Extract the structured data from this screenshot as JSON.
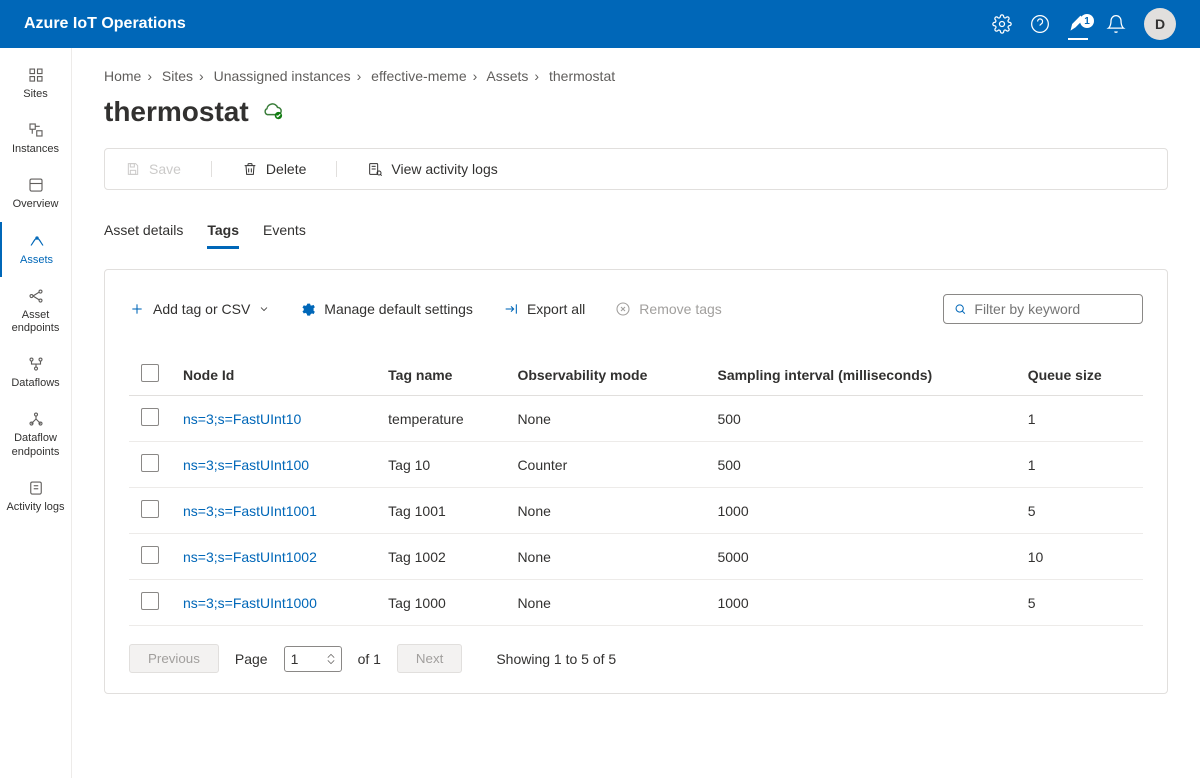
{
  "topbar": {
    "title": "Azure IoT Operations",
    "badge": "1",
    "avatar": "D"
  },
  "sidebar": {
    "items": [
      {
        "label": "Sites"
      },
      {
        "label": "Instances"
      },
      {
        "label": "Overview"
      },
      {
        "label": "Assets"
      },
      {
        "label": "Asset endpoints"
      },
      {
        "label": "Dataflows"
      },
      {
        "label": "Dataflow endpoints"
      },
      {
        "label": "Activity logs"
      }
    ]
  },
  "breadcrumb": {
    "items": [
      "Home",
      "Sites",
      "Unassigned instances",
      "effective-meme",
      "Assets",
      "thermostat"
    ]
  },
  "page": {
    "title": "thermostat"
  },
  "actions": {
    "save": "Save",
    "delete": "Delete",
    "logs": "View activity logs"
  },
  "tabs": {
    "items": [
      "Asset details",
      "Tags",
      "Events"
    ],
    "active": 1
  },
  "toolbar": {
    "add": "Add tag or CSV",
    "manage": "Manage default settings",
    "export": "Export all",
    "remove": "Remove tags",
    "filter_placeholder": "Filter by keyword"
  },
  "table": {
    "columns": [
      "Node Id",
      "Tag name",
      "Observability mode",
      "Sampling interval (milliseconds)",
      "Queue size"
    ],
    "rows": [
      {
        "node": "ns=3;s=FastUInt10",
        "tag": "temperature",
        "obs": "None",
        "samp": "500",
        "queue": "1"
      },
      {
        "node": "ns=3;s=FastUInt100",
        "tag": "Tag 10",
        "obs": "Counter",
        "samp": "500",
        "queue": "1"
      },
      {
        "node": "ns=3;s=FastUInt1001",
        "tag": "Tag 1001",
        "obs": "None",
        "samp": "1000",
        "queue": "5"
      },
      {
        "node": "ns=3;s=FastUInt1002",
        "tag": "Tag 1002",
        "obs": "None",
        "samp": "5000",
        "queue": "10"
      },
      {
        "node": "ns=3;s=FastUInt1000",
        "tag": "Tag 1000",
        "obs": "None",
        "samp": "1000",
        "queue": "5"
      }
    ]
  },
  "pager": {
    "prev": "Previous",
    "page_label": "Page",
    "page": "1",
    "of_label": "of 1",
    "next": "Next",
    "showing": "Showing 1 to 5 of 5"
  }
}
